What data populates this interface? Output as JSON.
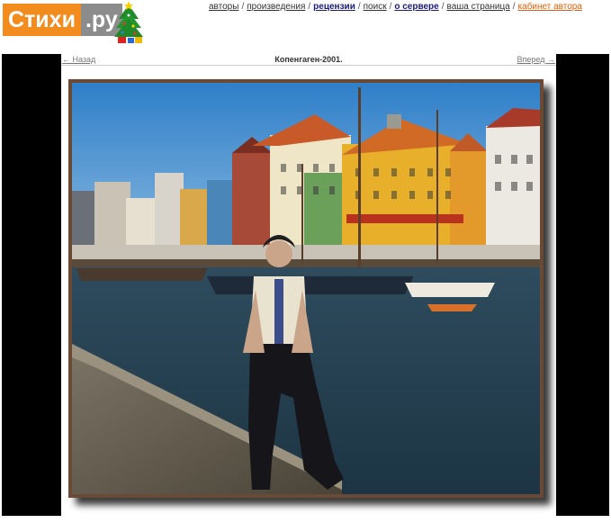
{
  "logo": {
    "left": "Стихи",
    "right": ".ру"
  },
  "nav": {
    "items": [
      {
        "label": "авторы",
        "style": "normal"
      },
      {
        "label": "произведения",
        "style": "normal"
      },
      {
        "label": "рецензии",
        "style": "bold"
      },
      {
        "label": "поиск",
        "style": "normal"
      },
      {
        "label": "о сервере",
        "style": "bold"
      },
      {
        "label": "ваша страница",
        "style": "normal"
      },
      {
        "label": "кабинет автора",
        "style": "cabinet"
      }
    ]
  },
  "pager": {
    "prev": "← Назад",
    "title": "Копенгаген-2001.",
    "next": "Вперед →"
  },
  "colors": {
    "logo_orange": "#f28c1e",
    "logo_gray": "#8c8c8c",
    "cabinet_link": "#e0600a"
  }
}
